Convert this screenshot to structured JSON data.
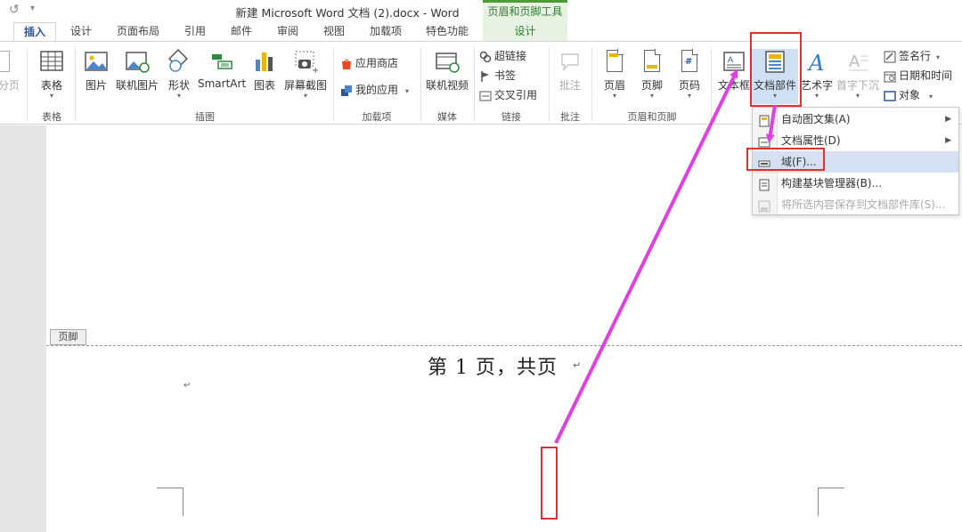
{
  "titlebar": {
    "undo_glyph": "↺",
    "qa_more_glyph": "▾",
    "title": "新建 Microsoft Word 文档 (2).docx - Word",
    "context_header": "页眉和页脚工具"
  },
  "tabs": {
    "items": [
      "插入",
      "设计",
      "页面布局",
      "引用",
      "邮件",
      "审阅",
      "视图",
      "加载项",
      "特色功能"
    ],
    "active": "插入",
    "context_tab": "设计"
  },
  "ribbon": {
    "partial_left_label": "分页",
    "groups": {
      "tables": {
        "label": "表格",
        "table_btn": "表格"
      },
      "illustrations": {
        "label": "插图",
        "picture": "图片",
        "online_picture": "联机图片",
        "shapes": "形状",
        "smartart": "SmartArt",
        "chart": "图表",
        "screenshot": "屏幕截图"
      },
      "addins": {
        "label": "加载项",
        "store": "应用商店",
        "my_apps": "我的应用"
      },
      "media": {
        "label": "媒体",
        "online_video": "联机视频"
      },
      "links": {
        "label": "链接",
        "hyperlink": "超链接",
        "bookmark": "书签",
        "cross_reference": "交叉引用"
      },
      "comments": {
        "label": "批注",
        "comment": "批注"
      },
      "header_footer": {
        "label": "页眉和页脚",
        "header": "页眉",
        "footer": "页脚",
        "page_number": "页码"
      },
      "text": {
        "textbox": "文本框",
        "quick_parts": "文档部件",
        "wordart": "艺术字",
        "drop_cap": "首字下沉",
        "signature_line": "签名行",
        "date_time": "日期和时间",
        "object": "对象"
      }
    }
  },
  "quick_parts_menu": {
    "items": [
      {
        "label": "自动图文集(A)",
        "has_submenu": true,
        "enabled": true
      },
      {
        "label": "文档属性(D)",
        "has_submenu": true,
        "enabled": true
      },
      {
        "label": "域(F)...",
        "has_submenu": false,
        "enabled": true,
        "highlighted": true
      },
      {
        "label": "构建基块管理器(B)...",
        "has_submenu": false,
        "enabled": true
      },
      {
        "label": "将所选内容保存到文档部件库(S)...",
        "has_submenu": false,
        "enabled": false
      }
    ],
    "submenu_glyph": "▶"
  },
  "document": {
    "footer_tag": "页脚",
    "footer_text": "第 1 页，共页",
    "paragraph_mark": "↵"
  },
  "colors": {
    "accent": "#2b579a",
    "context_green": "#4e9a3b",
    "annotation_red": "#e0312f",
    "annotation_arrow": "#e040e0",
    "menu_highlight": "#d5e1f2"
  }
}
